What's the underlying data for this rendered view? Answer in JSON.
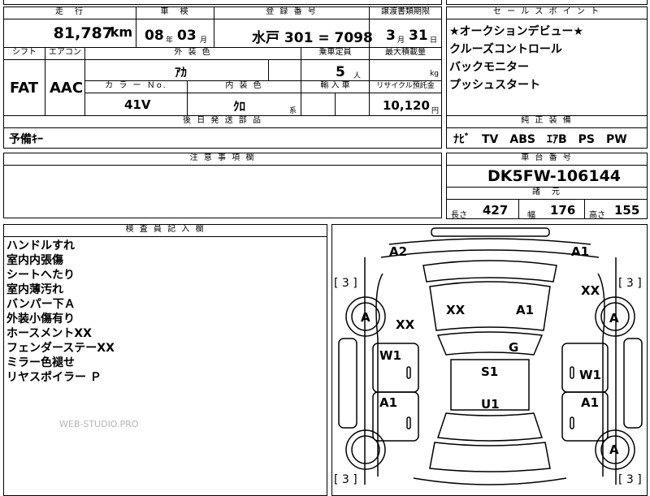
{
  "header": {
    "mileage_label": "走　行",
    "inspection_label": "車　検",
    "registration_label": "登 録 番 号",
    "transfer_label": "譲渡書類期限",
    "sales_points_label": "セ ー ル ス ポ イ ン ト"
  },
  "values": {
    "mileage": "81,787",
    "mileage_unit": "km",
    "inspection_year": "08",
    "inspection_year_unit": "年",
    "inspection_month": "03",
    "inspection_month_unit": "月",
    "registration": "水戸 301 = 7098",
    "transfer_month": "3",
    "transfer_month_unit": "月",
    "transfer_day": "31",
    "transfer_day_unit": "日"
  },
  "specs": {
    "shift_label": "シフト",
    "aircon_label": "エアコン",
    "exterior_color_label": "外 装 色",
    "capacity_label": "乗車定員",
    "max_load_label": "最大積載量",
    "shift": "FAT",
    "aircon": "AAC",
    "exterior_color": "ｱｶ",
    "capacity": "5",
    "capacity_unit": "人",
    "max_load_unit": "kg",
    "color_no_label": "カ ラ ー Ｎo.",
    "interior_label": "内 装 色",
    "import_label": "輸 入 車",
    "recycle_label": "リサイクル預託金",
    "color_no": "41V",
    "interior": "ｸﾛ",
    "interior_unit": "系",
    "recycle": "10,120",
    "recycle_unit": "円"
  },
  "sales_points": [
    "★オークションデビュー★",
    "クルーズコントロール",
    "バックモニター",
    "プッシュスタート"
  ],
  "later_parts": {
    "label": "後 日 発 送 部 品",
    "value": "予備ｷｰ"
  },
  "equipment": {
    "label": "純 正 装 備",
    "value": "ﾅﾋﾞ　TV　ABS　ｴｱB　PS　PW"
  },
  "notes": {
    "label": "注 意 事 項 欄"
  },
  "chassis": {
    "label": "車 台 番 号",
    "value": "DK5FW-106144"
  },
  "dims": {
    "label": "諸　元",
    "length_label": "長さ",
    "length": "427",
    "width_label": "幅",
    "width": "176",
    "height_label": "高さ",
    "height": "155"
  },
  "inspector": {
    "label": "検 査 員 記 入 欄",
    "items": [
      "ハンドルすれ",
      "室内内張傷",
      "シートへたり",
      "室内薄汚れ",
      "バンパー下Ａ",
      "外装小傷有り",
      "ホースメントXX",
      "フェンダーステーXX",
      "ミラー色褪せ",
      "リヤスポイラー Ｐ"
    ]
  },
  "watermark": "WEB-STUDIO.PRO",
  "diagram": {
    "marks": [
      "A2",
      "A1",
      "XX",
      "XX",
      "A1",
      "XX",
      "G",
      "W1",
      "S1",
      "W1",
      "A1",
      "U1",
      "A1",
      "A",
      "A",
      "A"
    ],
    "tire_labels": [
      "[ 3 ]",
      "[ 3 ]",
      "[ 3 ]",
      "[ 3 ]"
    ]
  }
}
